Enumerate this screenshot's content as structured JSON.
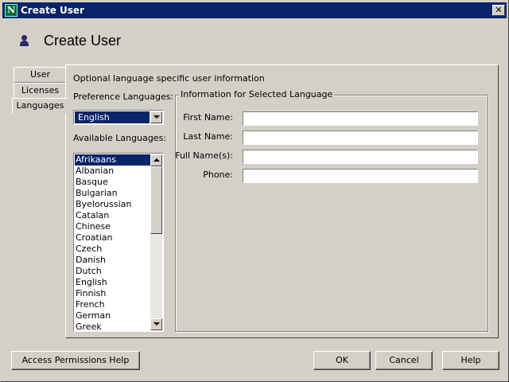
{
  "window": {
    "title": "Create User",
    "app_icon_letter": "N",
    "close_glyph": "✕"
  },
  "header": {
    "title": "Create User",
    "icon": "user-icon"
  },
  "tabs": [
    {
      "label": "User",
      "active": false
    },
    {
      "label": "Licenses",
      "active": false
    },
    {
      "label": "Languages",
      "active": true
    }
  ],
  "panel": {
    "description": "Optional language specific user information",
    "preference_label": "Preference Languages:",
    "preference_selected": "English",
    "available_label": "Available Languages:",
    "available_languages": [
      "Afrikaans",
      "Albanian",
      "Basque",
      "Bulgarian",
      "Byelorussian",
      "Catalan",
      "Chinese",
      "Croatian",
      "Czech",
      "Danish",
      "Dutch",
      "English",
      "Finnish",
      "French",
      "German",
      "Greek"
    ],
    "available_selected": "Afrikaans"
  },
  "group": {
    "title": "Information for Selected Language",
    "fields": [
      {
        "label": "First Name:",
        "value": ""
      },
      {
        "label": "Last Name:",
        "value": ""
      },
      {
        "label": "Full Name(s):",
        "value": ""
      },
      {
        "label": "Phone:",
        "value": ""
      }
    ]
  },
  "buttons": {
    "help_permissions": "Access Permissions Help",
    "ok": "OK",
    "cancel": "Cancel",
    "help": "Help"
  },
  "colors": {
    "titlebar": "#0a246a",
    "face": "#d4d0c8",
    "selection": "#0a246a"
  }
}
